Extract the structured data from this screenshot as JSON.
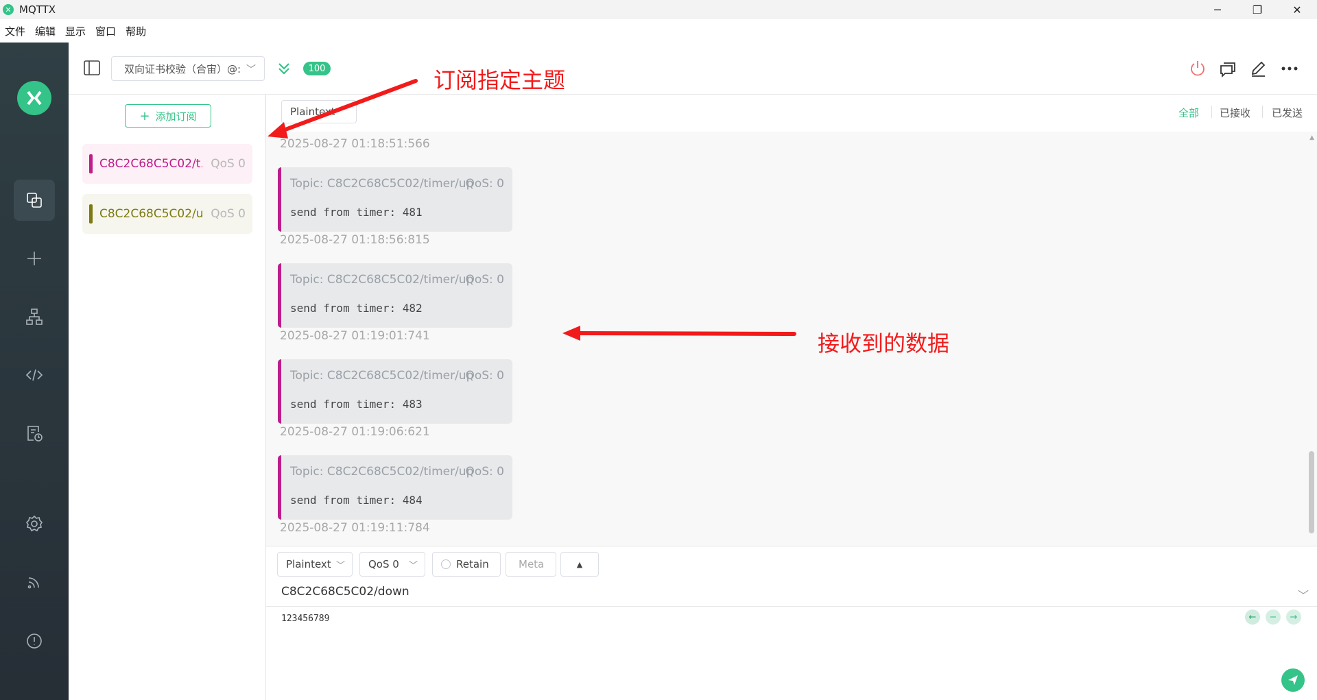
{
  "titlebar": {
    "app_name": "MQTTX",
    "minimize": "─",
    "restore": "❐",
    "close": "✕"
  },
  "menu": [
    "文件",
    "编辑",
    "显示",
    "窗口",
    "帮助"
  ],
  "header": {
    "connection_name": "双向证书校验（合宙）@:",
    "message_count": "100"
  },
  "subscriptions": {
    "add_label": "添加订阅",
    "items": [
      {
        "topic": "C8C2C68C5C02/t...",
        "qos": "QoS 0",
        "color": "#bd1e8a",
        "bg": "#fdf0f6"
      },
      {
        "topic": "C8C2C68C5C02/u...",
        "qos": "QoS 0",
        "color": "#7d7a12",
        "bg": "#f6f6ef"
      }
    ]
  },
  "toolbar": {
    "payload_format": "Plaintext",
    "filter_all": "全部",
    "filter_received": "已接收",
    "filter_sent": "已发送"
  },
  "messages": {
    "first_timestamp": "2025-08-27 01:18:51:566",
    "items": [
      {
        "topic": "Topic: C8C2C68C5C02/timer/up",
        "qos": "QoS: 0",
        "payload": "send from timer: 481",
        "timestamp": "2025-08-27 01:18:56:815"
      },
      {
        "topic": "Topic: C8C2C68C5C02/timer/up",
        "qos": "QoS: 0",
        "payload": "send from timer: 482",
        "timestamp": "2025-08-27 01:19:01:741"
      },
      {
        "topic": "Topic: C8C2C68C5C02/timer/up",
        "qos": "QoS: 0",
        "payload": "send from timer: 483",
        "timestamp": "2025-08-27 01:19:06:621"
      },
      {
        "topic": "Topic: C8C2C68C5C02/timer/up",
        "qos": "QoS: 0",
        "payload": "send from timer: 484",
        "timestamp": "2025-08-27 01:19:11:784"
      }
    ]
  },
  "publish": {
    "format": "Plaintext",
    "qos": "QoS 0",
    "retain": "Retain",
    "meta": "Meta",
    "topic": "C8C2C68C5C02/down",
    "payload": "123456789"
  },
  "annotations": {
    "subscribe_note": "订阅指定主题",
    "received_note": "接收到的数据"
  },
  "icons": [
    "connections-icon",
    "plus-icon",
    "topology-icon",
    "script-icon",
    "log-icon",
    "settings-icon",
    "feed-icon",
    "about-icon",
    "power-icon",
    "chat-icon",
    "edit-icon",
    "more-icon",
    "send-icon"
  ],
  "colors": {
    "accent": "#34c388",
    "sidebar": "#2b363d",
    "annotation": "#f21b1b",
    "danger": "#f56c6c"
  }
}
